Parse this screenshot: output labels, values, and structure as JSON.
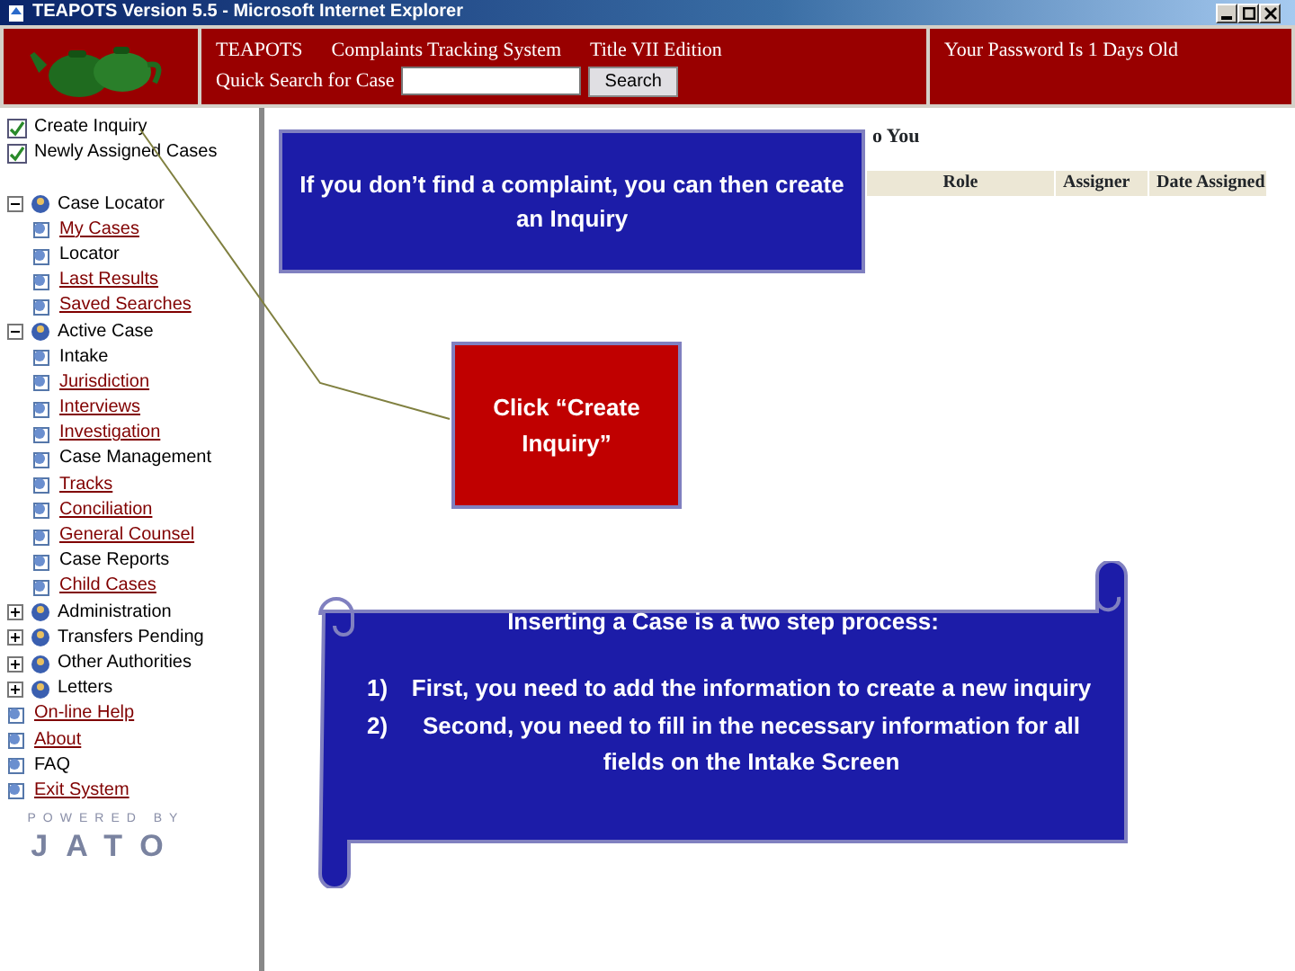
{
  "window": {
    "title": "TEAPOTS Version 5.5 - Microsoft Internet Explorer"
  },
  "header": {
    "titles": [
      "TEAPOTS",
      "Complaints Tracking System",
      "Title VII Edition"
    ],
    "search_label": "Quick Search for Case",
    "search_button": "Search",
    "notice": "Your Password Is 1 Days Old"
  },
  "sidebar": {
    "items": [
      {
        "kind": "action",
        "label": "Create Inquiry"
      },
      {
        "kind": "action",
        "label": "Newly Assigned Cases"
      },
      {
        "kind": "group",
        "label": "Case Locator",
        "expanded": true,
        "children": [
          {
            "label": "My Cases",
            "link": true
          },
          {
            "label": "Locator",
            "link": false
          },
          {
            "label": "Last Results",
            "link": true
          },
          {
            "label": "Saved Searches",
            "link": true
          }
        ]
      },
      {
        "kind": "group",
        "label": "Active Case",
        "expanded": true,
        "children": [
          {
            "label": "Intake",
            "link": false
          },
          {
            "label": "Jurisdiction",
            "link": true
          },
          {
            "label": "Interviews",
            "link": true
          },
          {
            "label": "Investigation",
            "link": true
          },
          {
            "label": "Case Management",
            "link": false
          },
          {
            "label": "Tracks",
            "link": true
          },
          {
            "label": "Conciliation",
            "link": true
          },
          {
            "label": "General Counsel",
            "link": true
          },
          {
            "label": "Case Reports",
            "link": false
          },
          {
            "label": "Child Cases",
            "link": true
          }
        ]
      },
      {
        "kind": "group",
        "label": "Administration",
        "expanded": false
      },
      {
        "kind": "group",
        "label": "Transfers Pending",
        "expanded": false
      },
      {
        "kind": "group",
        "label": "Other Authorities",
        "expanded": false
      },
      {
        "kind": "group",
        "label": "Letters",
        "expanded": false
      },
      {
        "kind": "page",
        "label": "On-line Help",
        "link": true
      },
      {
        "kind": "page",
        "label": "About",
        "link": true
      },
      {
        "kind": "page",
        "label": "FAQ",
        "link": false
      },
      {
        "kind": "page",
        "label": "Exit System",
        "link": true
      }
    ],
    "footer": [
      "POWERED BY",
      "JATO"
    ]
  },
  "main": {
    "heading": "o You",
    "columns": [
      "Role",
      "Assigner",
      "Date Assigned"
    ]
  },
  "callouts": [
    {
      "kind": "box",
      "color": "#1c1ca8",
      "text": "If you don’t find a complaint, you can then create an Inquiry"
    },
    {
      "kind": "box",
      "color": "#c00000",
      "text": "Click “Create Inquiry”"
    },
    {
      "kind": "scroll",
      "color": "#1c1ca8",
      "title": "Inserting a Case is a two step process:",
      "steps": [
        {
          "number": "1)",
          "text": "First, you need to add the information to create a new inquiry"
        },
        {
          "number": "2)",
          "text": "Second, you need to fill in the necessary information for all fields on the Intake Screen"
        }
      ]
    }
  ]
}
